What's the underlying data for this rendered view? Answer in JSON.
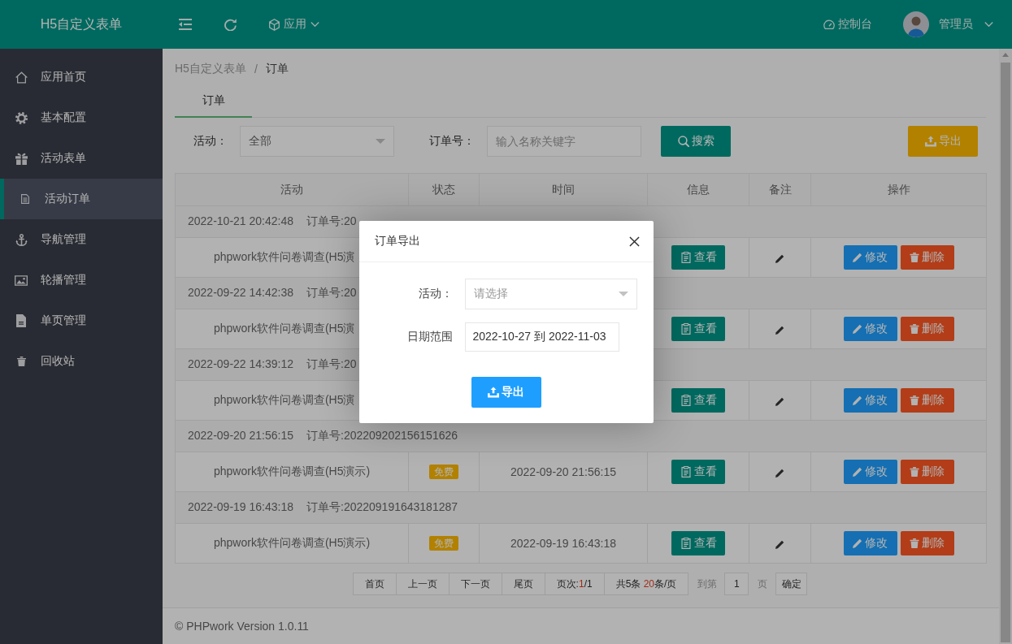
{
  "header": {
    "logo": "H5自定义表单",
    "app_menu": "应用",
    "console_link": "控制台",
    "user_name": "管理员"
  },
  "sidebar": {
    "items": [
      {
        "label": "应用首页",
        "selected": false
      },
      {
        "label": "基本配置",
        "selected": false
      },
      {
        "label": "活动表单",
        "selected": false
      },
      {
        "label": "活动订单",
        "selected": true
      },
      {
        "label": "导航管理",
        "selected": false
      },
      {
        "label": "轮播管理",
        "selected": false
      },
      {
        "label": "单页管理",
        "selected": false
      },
      {
        "label": "回收站",
        "selected": false
      }
    ]
  },
  "breadcrumb": {
    "items": [
      "H5自定义表单",
      "订单"
    ],
    "separator": "/"
  },
  "tabs": [
    {
      "label": "订单",
      "selected": true
    }
  ],
  "filters": {
    "activity_label": "活动：",
    "activity_value": "全部",
    "order_label": "订单号：",
    "order_placeholder": "输入名称关键字",
    "search_button": "搜索",
    "export_button": "导出"
  },
  "table": {
    "columns": [
      "活动",
      "状态",
      "时间",
      "信息",
      "备注",
      "操作"
    ],
    "orders": [
      {
        "created": "2022-10-21 20:42:48",
        "order_no": "订单号:20",
        "activity": "phpwork软件问卷调查(H5演",
        "view_button": "查看",
        "edit_button": "修改",
        "delete_button": "删除"
      },
      {
        "created": "2022-09-22 14:42:38",
        "order_no": "订单号:20",
        "activity": "phpwork软件问卷调查(H5演",
        "view_button": "查看",
        "edit_button": "修改",
        "delete_button": "删除"
      },
      {
        "created": "2022-09-22 14:39:12",
        "order_no": "订单号:20",
        "activity": "phpwork软件问卷调查(H5演",
        "view_button": "查看",
        "edit_button": "修改",
        "delete_button": "删除"
      },
      {
        "created": "2022-09-20 21:56:15",
        "order_no": "订单号:202209202156151626",
        "activity": "phpwork软件问卷调查(H5演示)",
        "status": "免费",
        "time": "2022-09-20 21:56:15",
        "view_button": "查看",
        "edit_button": "修改",
        "delete_button": "删除"
      },
      {
        "created": "2022-09-19 16:43:18",
        "order_no": "订单号:202209191643181287",
        "activity": "phpwork软件问卷调查(H5演示)",
        "status": "免费",
        "time": "2022-09-19 16:43:18",
        "view_button": "查看",
        "edit_button": "修改",
        "delete_button": "删除"
      }
    ]
  },
  "pagination": {
    "buttons": [
      "首页",
      "上一页",
      "下一页",
      "尾页"
    ],
    "page_info": {
      "prefix": "页次:",
      "current": "1",
      "suffix": "/1"
    },
    "total_info": {
      "prefix": "共5条 ",
      "per_page": "20",
      "suffix": "条/页"
    },
    "goto_label": "到第",
    "goto_value": "1",
    "goto_unit": "页",
    "confirm_button": "确定"
  },
  "footer": {
    "copyright": "© PHPwork Version 1.0.11"
  },
  "dialog": {
    "title": "订单导出",
    "fields": [
      {
        "kind": "select",
        "label": "活动：",
        "placeholder": "请选择"
      },
      {
        "kind": "input",
        "label": "日期范围",
        "value": "2022-10-27 到 2022-11-03"
      }
    ],
    "submit_button": "导出"
  }
}
